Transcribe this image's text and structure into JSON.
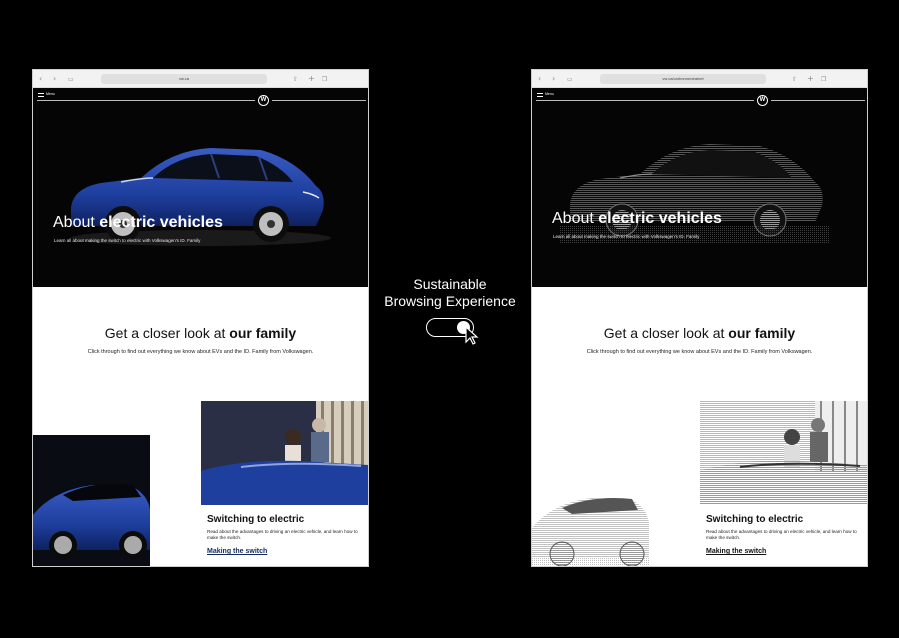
{
  "colors": {
    "background": "#000000",
    "car_blue": "#1e3f9e",
    "link_blue": "#132a5e",
    "hero_bg": "#050505"
  },
  "icons": [
    "back-icon",
    "forward-icon",
    "book-icon",
    "share-icon",
    "plus-icon",
    "tabs-icon",
    "menu-icon",
    "vw-logo-icon",
    "toggle-icon",
    "cursor-icon"
  ],
  "center": {
    "line1": "Sustainable",
    "line2": "Browsing Experience",
    "toggle_state": "on"
  },
  "left": {
    "url": "vw.ca",
    "menu_label": "Menu",
    "logo": "W",
    "hero_title_light": "About ",
    "hero_title_bold": "electric vehicles",
    "hero_sub": "Learn all about making the switch to electric with Volkswagen's ID. Family",
    "section_title_light": "Get a closer look at ",
    "section_title_bold": "our family",
    "section_sub": "Click through to find out everything we know about EVs and the ID. Family from Volkswagen.",
    "switch_title": "Switching to electric",
    "switch_desc": "Read about the advantages to driving an electric vehicle, and learn how to make the switch.",
    "switch_link": "Making the switch"
  },
  "right": {
    "url": "vw.ca/carbonneutralnet",
    "menu_label": "Menu",
    "logo": "W",
    "hero_title_light": "About ",
    "hero_title_bold": "electric vehicles",
    "hero_sub": "Learn all about making the switch to electric with Volkswagen's ID. Family",
    "section_title_light": "Get a closer look at ",
    "section_title_bold": "our family",
    "section_sub": "Click through to find out everything we know about EVs and the ID. Family from Volkswagen.",
    "switch_title": "Switching to electric",
    "switch_desc": "Read about the advantages to driving an electric vehicle, and learn how to make the switch.",
    "switch_link": "Making the switch"
  }
}
